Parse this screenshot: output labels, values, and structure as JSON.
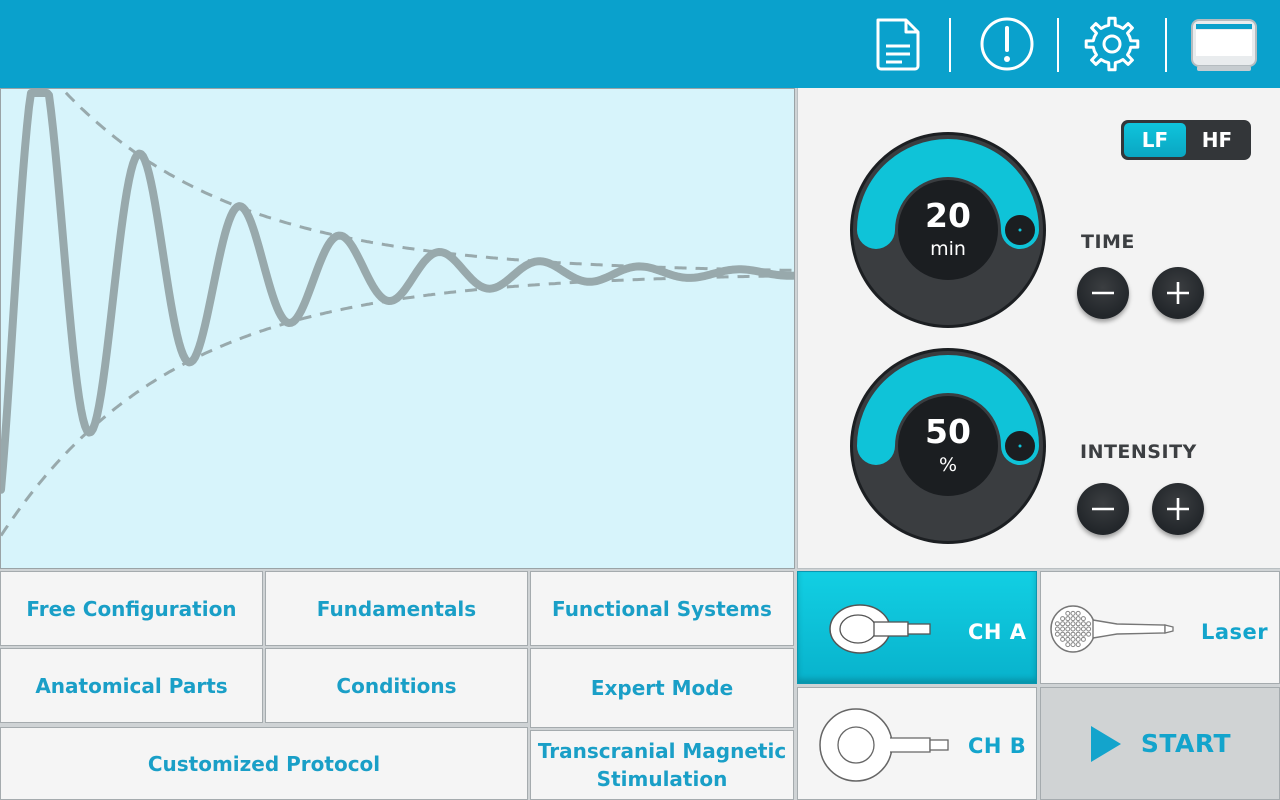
{
  "header": {
    "icons": [
      "document-icon",
      "alert-icon",
      "gear-icon",
      "device-icon"
    ],
    "bar_color": "#0aa1cc"
  },
  "waveform": {
    "type": "damped-oscillation",
    "line_color": "#98a9ac",
    "envelope_style": "dashed",
    "background": "#d7f4fb"
  },
  "mode_toggle": {
    "options": [
      "LF",
      "HF"
    ],
    "selected": "LF"
  },
  "time_control": {
    "label": "TIME",
    "value": "20",
    "unit": "min",
    "level": 0.5
  },
  "intensity_control": {
    "label": "INTENSITY",
    "value": "50",
    "unit": "%",
    "level": 0.5
  },
  "menu": {
    "free_configuration": "Free Configuration",
    "fundamentals": "Fundamentals",
    "functional_systems": "Functional Systems",
    "anatomical_parts": "Anatomical Parts",
    "conditions": "Conditions",
    "expert_mode": "Expert Mode",
    "customized_protocol": "Customized Protocol",
    "tms_line1": "Transcranial Magnetic",
    "tms_line2": "Stimulation"
  },
  "channels": {
    "ch_a": "CH A",
    "ch_b": "CH B",
    "laser": "Laser",
    "selected": "CH A"
  },
  "start": {
    "label": "START"
  },
  "colors": {
    "accent": "#0aa1cc",
    "cyan": "#13c6d9",
    "dark": "#2b2f33",
    "text_blue": "#1a9fc7"
  }
}
